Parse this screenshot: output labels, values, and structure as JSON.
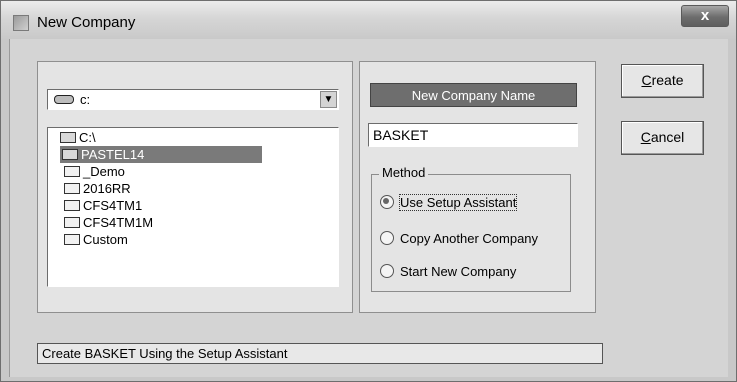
{
  "window": {
    "title": "New Company",
    "close_glyph": "x",
    "close_icon": "close-icon"
  },
  "drive": {
    "label": "c:",
    "icon": "drive-icon",
    "dropdown_glyph": "▼"
  },
  "folders": [
    {
      "label": "C:\\",
      "state": "open",
      "selected": false
    },
    {
      "label": "PASTEL14",
      "state": "open",
      "selected": true
    },
    {
      "label": "_Demo",
      "state": "closed",
      "selected": false
    },
    {
      "label": "2016RR",
      "state": "closed",
      "selected": false
    },
    {
      "label": "CFS4TM1",
      "state": "closed",
      "selected": false
    },
    {
      "label": "CFS4TM1M",
      "state": "closed",
      "selected": false
    },
    {
      "label": "Custom",
      "state": "closed",
      "selected": false
    }
  ],
  "company": {
    "heading": "New Company Name",
    "name_value": "BASKET"
  },
  "method": {
    "legend": "Method",
    "options": [
      {
        "label": "Use Setup Assistant",
        "checked": true
      },
      {
        "label": "Copy Another Company",
        "checked": false
      },
      {
        "label": "Start New Company",
        "checked": false
      }
    ]
  },
  "buttons": {
    "create": {
      "mnemonic": "C",
      "rest": "reate"
    },
    "cancel": {
      "mnemonic": "C",
      "rest": "ancel"
    }
  },
  "status": "Create BASKET Using the Setup Assistant",
  "colors": {
    "selection": "#7a7a7a",
    "heading_bar": "#6e6e6e"
  }
}
